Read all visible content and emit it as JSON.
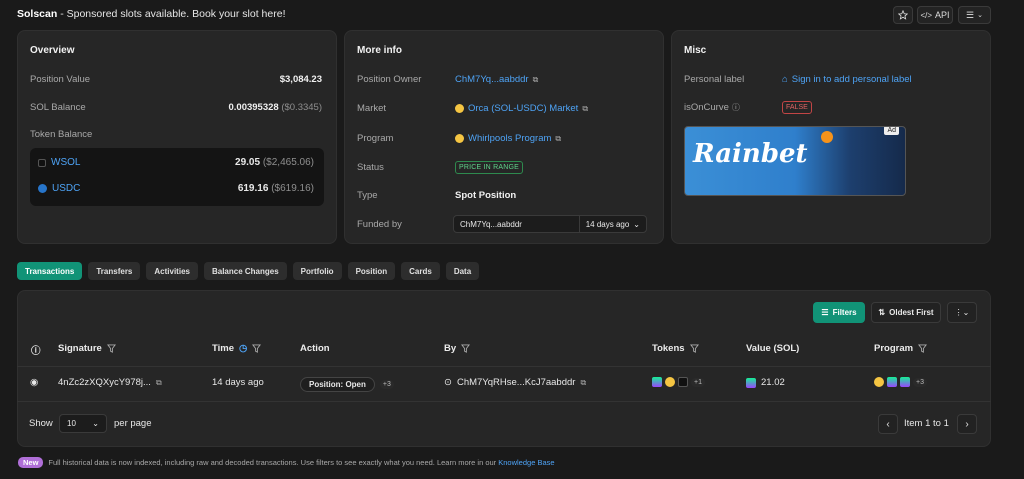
{
  "banner": {
    "brand": "Solscan",
    "text": " - Sponsored slots available. Book your slot here!",
    "api_label": "API"
  },
  "overview": {
    "title": "Overview",
    "position_value_label": "Position Value",
    "position_value": "$3,084.23",
    "sol_balance_label": "SOL Balance",
    "sol_balance": "0.00395328",
    "sol_balance_usd": "($0.3345)",
    "token_balance_label": "Token Balance",
    "tokens": [
      {
        "symbol": "WSOL",
        "amount": "29.05",
        "usd": "($2,465.06)"
      },
      {
        "symbol": "USDC",
        "amount": "619.16",
        "usd": "($619.16)"
      }
    ]
  },
  "more_info": {
    "title": "More info",
    "owner_label": "Position Owner",
    "owner": "ChM7Yq...aabddr",
    "market_label": "Market",
    "market": "Orca (SOL-USDC) Market",
    "program_label": "Program",
    "program": "Whirlpools Program",
    "status_label": "Status",
    "status": "PRICE IN RANGE",
    "type_label": "Type",
    "type": "Spot Position",
    "funded_label": "Funded by",
    "funded_by": "ChM7Yq...aabddr",
    "funded_time": "14 days ago"
  },
  "misc": {
    "title": "Misc",
    "personal_label": "Personal label",
    "sign_in": "Sign in to add personal label",
    "oncurve_label": "isOnCurve",
    "oncurve_value": "FALSE",
    "ad_tag": "Ad",
    "ad_brand": "Rainbet"
  },
  "tabs": [
    "Transactions",
    "Transfers",
    "Activities",
    "Balance Changes",
    "Portfolio",
    "Position",
    "Cards",
    "Data"
  ],
  "table": {
    "filters_label": "Filters",
    "sort_label": "Oldest First",
    "headers": {
      "signature": "Signature",
      "time": "Time",
      "action": "Action",
      "by": "By",
      "tokens": "Tokens",
      "value": "Value (SOL)",
      "program": "Program"
    },
    "rows": [
      {
        "signature": "4nZc2zXQXycY978j...",
        "time": "14 days ago",
        "action": "Position: Open",
        "action_more": "+3",
        "by": "ChM7YqRHse...KcJ7aabddr",
        "tokens_more": "+1",
        "value": "21.02",
        "program_more": "+3"
      }
    ],
    "show_label": "Show",
    "per_page_value": "10",
    "per_page_label": "per page",
    "pagination": "Item 1 to 1"
  },
  "footer": {
    "new_badge": "New",
    "text": "Full historical data is now indexed, including raw and decoded transactions. Use filters to see exactly what you need. Learn more in our ",
    "link": "Knowledge Base"
  },
  "colors": {
    "accent": "#119377",
    "link": "#4ea3f5",
    "bg": "#1a1a1a",
    "card": "#262626"
  }
}
